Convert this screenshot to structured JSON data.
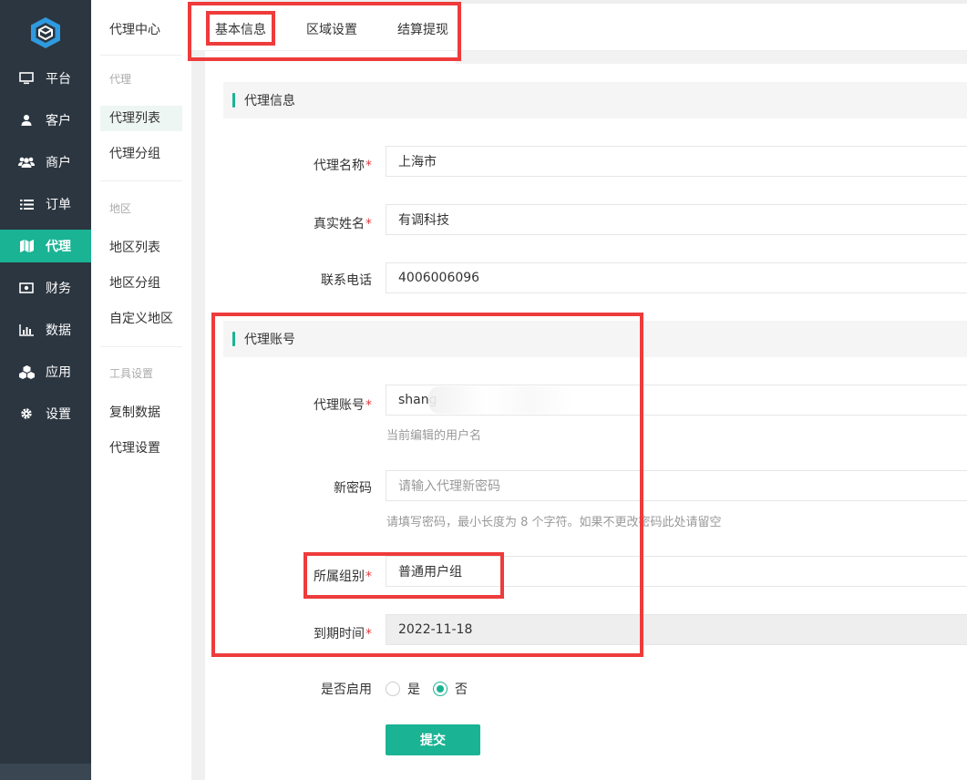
{
  "nav": {
    "items": [
      {
        "label": "平台",
        "icon": "monitor-icon"
      },
      {
        "label": "客户",
        "icon": "user-icon"
      },
      {
        "label": "商户",
        "icon": "users-icon"
      },
      {
        "label": "订单",
        "icon": "list-icon"
      },
      {
        "label": "代理",
        "icon": "map-icon",
        "active": true
      },
      {
        "label": "财务",
        "icon": "money-icon"
      },
      {
        "label": "数据",
        "icon": "bar-chart-icon"
      },
      {
        "label": "应用",
        "icon": "cubes-icon"
      },
      {
        "label": "设置",
        "icon": "gear-icon"
      }
    ]
  },
  "sub": {
    "title": "代理中心",
    "sections": [
      {
        "label": "代理",
        "items": [
          "代理列表",
          "代理分组"
        ]
      },
      {
        "label": "地区",
        "items": [
          "地区列表",
          "地区分组",
          "自定义地区"
        ]
      },
      {
        "label": "工具设置",
        "items": [
          "复制数据",
          "代理设置"
        ]
      }
    ],
    "active_item": "代理列表"
  },
  "tabs": [
    "基本信息",
    "区域设置",
    "结算提现"
  ],
  "sections": {
    "info": "代理信息",
    "account": "代理账号"
  },
  "form": {
    "agent_name": {
      "label": "代理名称",
      "value": "上海市"
    },
    "real_name": {
      "label": "真实姓名",
      "value": "有调科技"
    },
    "phone": {
      "label": "联系电话",
      "value": "4006006096"
    },
    "account": {
      "label": "代理账号",
      "value": "shang",
      "help": "当前编辑的用户名"
    },
    "password": {
      "label": "新密码",
      "placeholder": "请输入代理新密码",
      "help": "请填写密码，最小长度为 8 个字符。如果不更改密码此处请留空"
    },
    "group": {
      "label": "所属组别",
      "value": "普通用户组"
    },
    "expire": {
      "label": "到期时间",
      "value": "2022-11-18"
    },
    "enabled": {
      "label": "是否启用",
      "options": [
        "是",
        "否"
      ],
      "selected": "否"
    }
  },
  "submit_label": "提交",
  "colors": {
    "accent": "#1ab394",
    "sidebar": "#2b3640",
    "highlight": "#ee3b3b"
  }
}
